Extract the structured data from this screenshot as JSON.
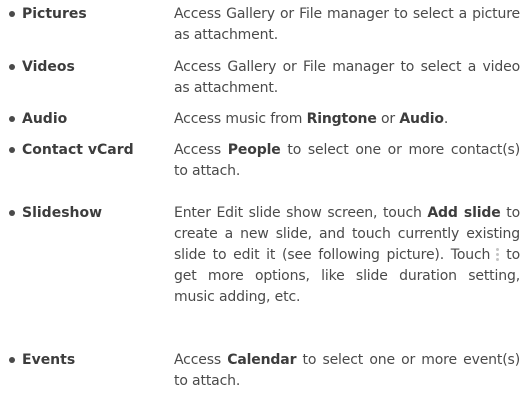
{
  "items": [
    {
      "term": "Pictures",
      "desc": "Access Gallery or File manager to select a picture as attachment."
    },
    {
      "term": "Videos",
      "desc": "Access Gallery or File manager to select a video as attachment."
    },
    {
      "term": "Audio",
      "desc_pre": "Access music from ",
      "bold1": "Ringtone",
      "mid": " or ",
      "bold2": "Audio",
      "post": "."
    },
    {
      "term": "Contact vCard",
      "desc_pre": "Access ",
      "bold1": "People",
      "post": " to select one or more contact(s) to attach."
    },
    {
      "term": "Slideshow",
      "desc_pre": "Enter Edit slide show screen, touch ",
      "bold1": "Add slide",
      "mid": " to create a new slide, and touch currently existing slide to edit it (see following picture). Touch",
      "icon": "more-options-icon",
      "post": "to get more options, like slide duration setting, music adding, etc."
    },
    {
      "term": "Events",
      "desc_pre": "Access ",
      "bold1": "Calendar",
      "post": " to select one or more event(s) to attach."
    }
  ],
  "colors": {
    "text": "#4a4a4a",
    "icon": "#c4c4c4"
  }
}
